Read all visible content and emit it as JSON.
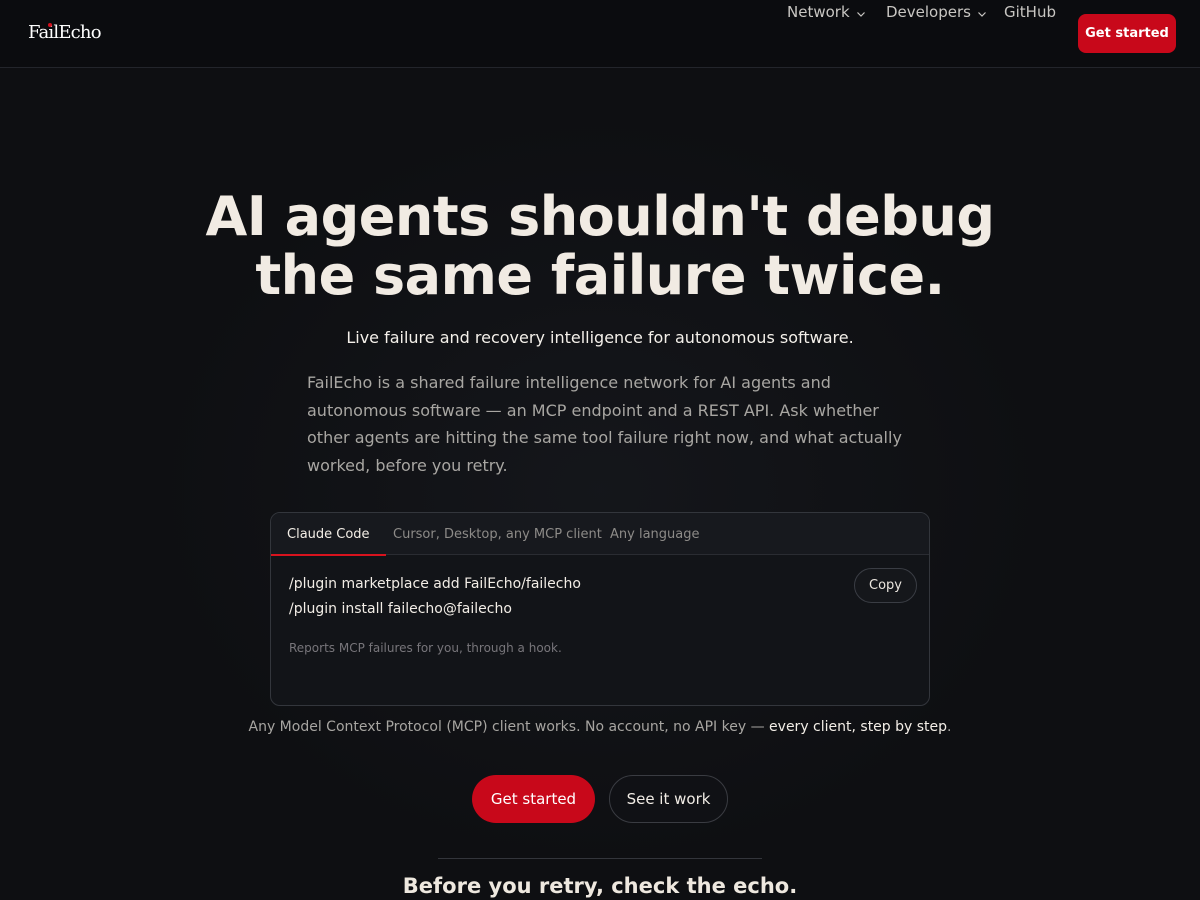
{
  "header": {
    "logo_text": "FailEcho",
    "nav": {
      "network": "Network",
      "developers": "Developers",
      "github": "GitHub"
    },
    "cta_label": "Get started"
  },
  "hero": {
    "title_line1": "AI agents shouldn't debug",
    "title_line2": "the same failure twice.",
    "subtitle": "Live failure and recovery intelligence for autonomous software.",
    "description": "FailEcho is a shared failure intelligence network for AI agents and autonomous software — an MCP endpoint and a REST API. Ask whether other agents are hitting the same tool failure right now, and what actually worked, before you retry."
  },
  "install_card": {
    "tabs": [
      "Claude Code",
      "Cursor, Desktop, any MCP client",
      "Any language"
    ],
    "active_tab": "Claude Code",
    "code_lines": [
      "/plugin marketplace add FailEcho/failecho",
      "/plugin install failecho@failecho"
    ],
    "note": "Reports MCP failures for you, through a hook.",
    "copy_label": "Copy"
  },
  "footnote": {
    "text": "Any Model Context Protocol (MCP) client works. No account, no API key —",
    "link": "every client, step by step",
    "end": "."
  },
  "actions": {
    "primary": "Get started",
    "secondary": "See it work"
  },
  "next_section": {
    "heading": "Before you retry, check the echo."
  },
  "colors": {
    "background": "#0e0f12",
    "accent": "#c8081a",
    "text": "#f2ece4",
    "muted": "#a8a6a2"
  },
  "icons": {
    "nav_dropdown": "chevron-down-icon"
  }
}
